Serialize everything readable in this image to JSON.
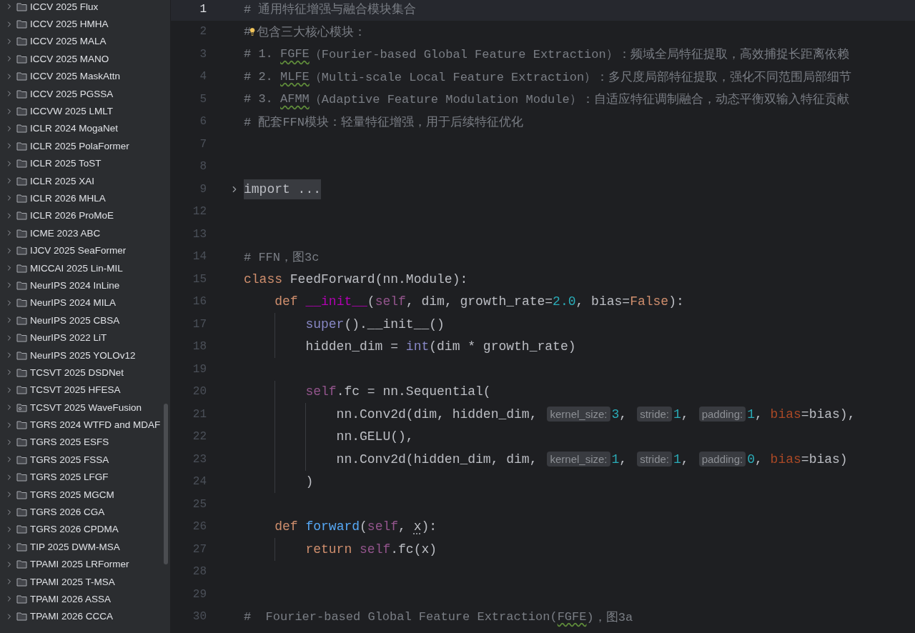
{
  "project_tree": {
    "items": [
      {
        "label": "ICCV 2025 Flux",
        "kind": "folder",
        "expanded": false
      },
      {
        "label": "ICCV 2025 HMHA",
        "kind": "folder",
        "expanded": false
      },
      {
        "label": "ICCV 2025 MALA",
        "kind": "folder",
        "expanded": false
      },
      {
        "label": "ICCV 2025 MANO",
        "kind": "folder",
        "expanded": false
      },
      {
        "label": "ICCV 2025 MaskAttn",
        "kind": "folder",
        "expanded": false
      },
      {
        "label": "ICCV 2025 PGSSA",
        "kind": "folder",
        "expanded": false
      },
      {
        "label": "ICCVW 2025 LMLT",
        "kind": "folder",
        "expanded": false
      },
      {
        "label": "ICLR 2024 MogaNet",
        "kind": "folder",
        "expanded": false
      },
      {
        "label": "ICLR 2025 PolaFormer",
        "kind": "folder",
        "expanded": false
      },
      {
        "label": "ICLR 2025 ToST",
        "kind": "folder",
        "expanded": false
      },
      {
        "label": "ICLR 2025 XAI",
        "kind": "folder",
        "expanded": false
      },
      {
        "label": "ICLR 2026 MHLA",
        "kind": "folder",
        "expanded": false
      },
      {
        "label": "ICLR 2026 ProMoE",
        "kind": "folder",
        "expanded": false
      },
      {
        "label": "ICME 2023 ABC",
        "kind": "folder",
        "expanded": false
      },
      {
        "label": "IJCV 2025 SeaFormer",
        "kind": "folder",
        "expanded": false
      },
      {
        "label": "MICCAI 2025 Lin-MIL",
        "kind": "folder",
        "expanded": false
      },
      {
        "label": "NeurIPS 2024 InLine",
        "kind": "folder",
        "expanded": false
      },
      {
        "label": "NeurIPS 2024 MILA",
        "kind": "folder",
        "expanded": false
      },
      {
        "label": "NeurIPS 2025 CBSA",
        "kind": "folder",
        "expanded": false
      },
      {
        "label": "NeurIPS 2022 LiT",
        "kind": "folder",
        "expanded": false
      },
      {
        "label": "NeurIPS 2025 YOLOv12",
        "kind": "folder",
        "expanded": false
      },
      {
        "label": "TCSVT 2025 DSDNet",
        "kind": "folder",
        "expanded": false
      },
      {
        "label": "TCSVT 2025 HFESA",
        "kind": "folder",
        "expanded": false
      },
      {
        "label": "TCSVT 2025 WaveFusion",
        "kind": "module",
        "expanded": false
      },
      {
        "label": "TGRS 2024 WTFD and MDAF",
        "kind": "folder",
        "expanded": false
      },
      {
        "label": "TGRS 2025 ESFS",
        "kind": "folder",
        "expanded": false
      },
      {
        "label": "TGRS 2025 FSSA",
        "kind": "folder",
        "expanded": false
      },
      {
        "label": "TGRS 2025 LFGF",
        "kind": "folder",
        "expanded": false
      },
      {
        "label": "TGRS 2025 MGCM",
        "kind": "folder",
        "expanded": false
      },
      {
        "label": "TGRS 2026 CGA",
        "kind": "folder",
        "expanded": false
      },
      {
        "label": "TGRS 2026 CPDMA",
        "kind": "folder",
        "expanded": false
      },
      {
        "label": "TIP 2025 DWM-MSA",
        "kind": "folder",
        "expanded": false
      },
      {
        "label": "TPAMI 2025 LRFormer",
        "kind": "folder",
        "expanded": false
      },
      {
        "label": "TPAMI 2025 T-MSA",
        "kind": "folder",
        "expanded": false
      },
      {
        "label": "TPAMI 2026 ASSA",
        "kind": "folder",
        "expanded": false
      },
      {
        "label": "TPAMI 2026 CCCA",
        "kind": "folder",
        "expanded": false
      }
    ]
  },
  "editor": {
    "lines": [
      {
        "number": "1",
        "current": true,
        "folded": false,
        "tokens": [
          {
            "kind": "comment",
            "text": "# 通用特征增强与融合模块集合"
          }
        ]
      },
      {
        "number": "2",
        "current": false,
        "folded": false,
        "tokens": [
          {
            "kind": "comment",
            "text": "#"
          },
          {
            "kind": "bulb"
          },
          {
            "kind": "comment",
            "text": "包含三大核心模块："
          }
        ]
      },
      {
        "number": "3",
        "current": false,
        "folded": false,
        "tokens": [
          {
            "kind": "comment",
            "text": "# 1. "
          },
          {
            "kind": "typo",
            "text": "FGFE"
          },
          {
            "kind": "comment",
            "text": "（Fourier-based Global Feature Extraction）：频域全局特征提取，高效捕捉长距离依赖"
          }
        ]
      },
      {
        "number": "4",
        "current": false,
        "folded": false,
        "tokens": [
          {
            "kind": "comment",
            "text": "# 2. "
          },
          {
            "kind": "typo",
            "text": "MLFE"
          },
          {
            "kind": "comment",
            "text": "（Multi-scale Local Feature Extraction）：多尺度局部特征提取，强化不同范围局部细节"
          }
        ]
      },
      {
        "number": "5",
        "current": false,
        "folded": false,
        "tokens": [
          {
            "kind": "comment",
            "text": "# 3. "
          },
          {
            "kind": "typo",
            "text": "AFMM"
          },
          {
            "kind": "comment",
            "text": "（Adaptive Feature Modulation Module）：自适应特征调制融合，动态平衡双输入特征贡献"
          }
        ]
      },
      {
        "number": "6",
        "current": false,
        "folded": false,
        "tokens": [
          {
            "kind": "comment",
            "text": "# 配套FFN模块：轻量特征增强，用于后续特征优化"
          }
        ]
      },
      {
        "number": "7",
        "current": false,
        "folded": false
      },
      {
        "number": "8",
        "current": false,
        "folded": false
      },
      {
        "number": "9",
        "current": false,
        "folded": true,
        "tokens": [
          {
            "kind": "plain",
            "text": "import ..."
          }
        ]
      },
      {
        "number": "12",
        "current": false,
        "folded": false
      },
      {
        "number": "13",
        "current": false,
        "folded": false
      },
      {
        "number": "14",
        "current": false,
        "folded": false,
        "tokens": [
          {
            "kind": "comment",
            "text": "# FFN，图3c"
          }
        ]
      },
      {
        "number": "15",
        "current": false,
        "folded": false,
        "tokens": [
          {
            "kind": "keyword",
            "text": "class"
          },
          {
            "kind": "plain",
            "text": " FeedForward(nn.Module):"
          }
        ],
        "children": [
          {
            "number": "16",
            "current": false,
            "folded": false,
            "tokens": [
              {
                "kind": "keyword",
                "text": "def "
              },
              {
                "kind": "dunder",
                "text": "__init__"
              },
              {
                "kind": "plain",
                "text": "("
              },
              {
                "kind": "self",
                "text": "self"
              },
              {
                "kind": "plain",
                "text": ", dim, growth_rate="
              },
              {
                "kind": "number",
                "text": "2.0"
              },
              {
                "kind": "plain",
                "text": ", bias="
              },
              {
                "kind": "keyword",
                "text": "False"
              },
              {
                "kind": "plain",
                "text": "):"
              }
            ],
            "children": [
              {
                "number": "17",
                "current": false,
                "folded": false,
                "tokens": [
                  {
                    "kind": "builtin",
                    "text": "super"
                  },
                  {
                    "kind": "plain",
                    "text": "().__init__()"
                  }
                ]
              },
              {
                "number": "18",
                "current": false,
                "folded": false,
                "tokens": [
                  {
                    "kind": "plain",
                    "text": "hidden_dim = "
                  },
                  {
                    "kind": "builtin",
                    "text": "int"
                  },
                  {
                    "kind": "plain",
                    "text": "(dim * growth_rate)"
                  }
                ]
              },
              {
                "number": "19",
                "current": false,
                "folded": false
              },
              {
                "number": "20",
                "current": false,
                "folded": false,
                "tokens": [
                  {
                    "kind": "self",
                    "text": "self"
                  },
                  {
                    "kind": "plain",
                    "text": ".fc = nn.Sequential("
                  }
                ],
                "children": [
                  {
                    "number": "21",
                    "current": false,
                    "folded": false,
                    "tokens": [
                      {
                        "kind": "plain",
                        "text": "nn.Conv2d(dim, hidden_dim,"
                      },
                      {
                        "kind": "hint",
                        "text": "kernel_size:"
                      },
                      {
                        "kind": "number",
                        "text": "3"
                      },
                      {
                        "kind": "plain",
                        "text": ","
                      },
                      {
                        "kind": "hint",
                        "text": "stride:"
                      },
                      {
                        "kind": "number",
                        "text": "1"
                      },
                      {
                        "kind": "plain",
                        "text": ","
                      },
                      {
                        "kind": "hint",
                        "text": "padding:"
                      },
                      {
                        "kind": "number",
                        "text": "1"
                      },
                      {
                        "kind": "plain",
                        "text": ", "
                      },
                      {
                        "kind": "kwarg",
                        "text": "bias"
                      },
                      {
                        "kind": "plain",
                        "text": "=bias),"
                      }
                    ]
                  },
                  {
                    "number": "22",
                    "current": false,
                    "folded": false,
                    "tokens": [
                      {
                        "kind": "plain",
                        "text": "nn.GELU(),"
                      }
                    ]
                  },
                  {
                    "number": "23",
                    "current": false,
                    "folded": false,
                    "tokens": [
                      {
                        "kind": "plain",
                        "text": "nn.Conv2d(hidden_dim, dim,"
                      },
                      {
                        "kind": "hint",
                        "text": "kernel_size:"
                      },
                      {
                        "kind": "number",
                        "text": "1"
                      },
                      {
                        "kind": "plain",
                        "text": ","
                      },
                      {
                        "kind": "hint",
                        "text": "stride:"
                      },
                      {
                        "kind": "number",
                        "text": "1"
                      },
                      {
                        "kind": "plain",
                        "text": ","
                      },
                      {
                        "kind": "hint",
                        "text": "padding:"
                      },
                      {
                        "kind": "number",
                        "text": "0"
                      },
                      {
                        "kind": "plain",
                        "text": ", "
                      },
                      {
                        "kind": "kwarg",
                        "text": "bias"
                      },
                      {
                        "kind": "plain",
                        "text": "=bias)"
                      }
                    ]
                  }
                ]
              },
              {
                "number": "24",
                "current": false,
                "folded": false,
                "tokens": [
                  {
                    "kind": "plain",
                    "text": ")"
                  }
                ]
              }
            ]
          },
          {
            "number": "25",
            "current": false,
            "folded": false
          },
          {
            "number": "26",
            "current": false,
            "folded": false,
            "tokens": [
              {
                "kind": "keyword",
                "text": "def "
              },
              {
                "kind": "function",
                "text": "forward"
              },
              {
                "kind": "plain",
                "text": "("
              },
              {
                "kind": "self",
                "text": "self"
              },
              {
                "kind": "plain",
                "text": ", "
              },
              {
                "kind": "unused",
                "text": "x"
              },
              {
                "kind": "plain",
                "text": "):"
              }
            ],
            "children": [
              {
                "number": "27",
                "current": false,
                "folded": false,
                "tokens": [
                  {
                    "kind": "keyword",
                    "text": "return "
                  },
                  {
                    "kind": "self",
                    "text": "self"
                  },
                  {
                    "kind": "plain",
                    "text": ".fc(x)"
                  }
                ]
              }
            ]
          }
        ]
      },
      {
        "number": "28",
        "current": false,
        "folded": false
      },
      {
        "number": "29",
        "current": false,
        "folded": false
      },
      {
        "number": "30",
        "current": false,
        "folded": false,
        "tokens": [
          {
            "kind": "comment",
            "text": "#  Fourier-based Global Feature Extraction("
          },
          {
            "kind": "typo",
            "text": "FGFE"
          },
          {
            "kind": "comment",
            "text": ")，图3a"
          }
        ]
      }
    ]
  }
}
